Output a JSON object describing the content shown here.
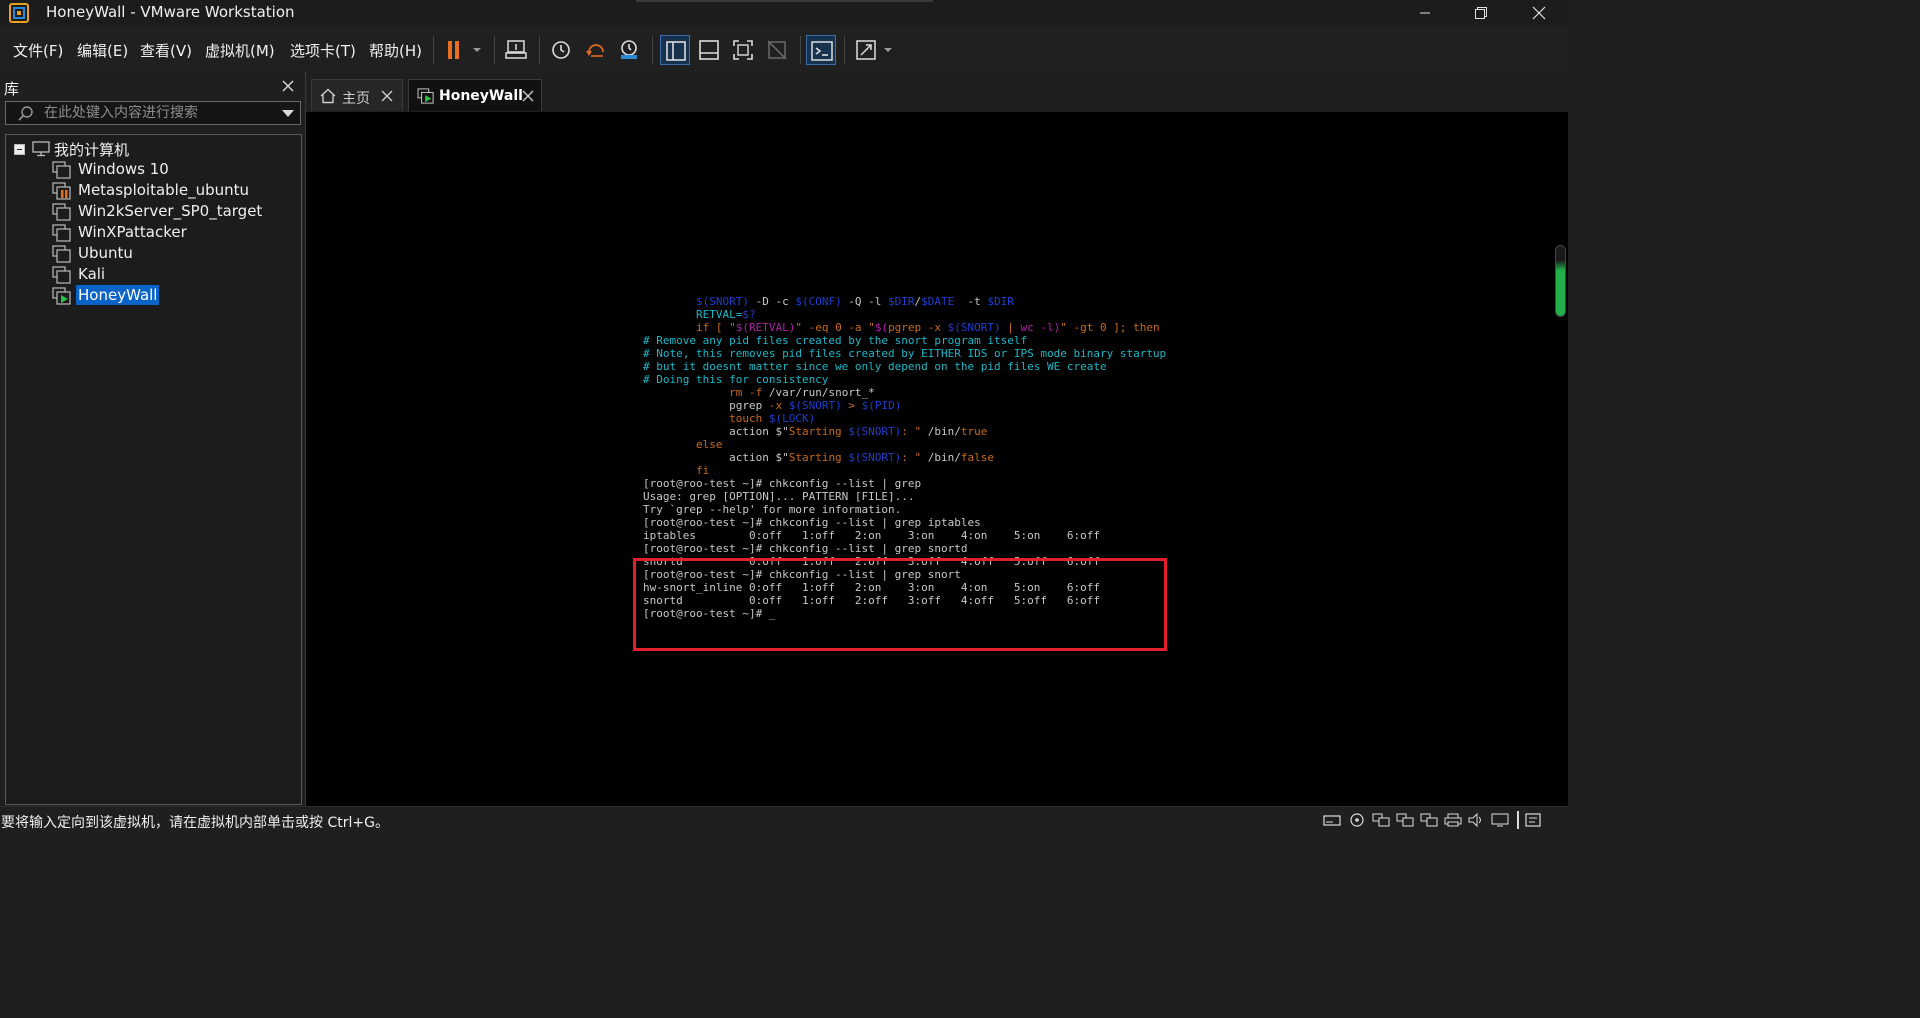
{
  "window": {
    "title": "HoneyWall - VMware Workstation"
  },
  "menu": {
    "items": [
      "文件(F)",
      "编辑(E)",
      "查看(V)",
      "虚拟机(M)",
      "选项卡(T)",
      "帮助(H)"
    ]
  },
  "toolbar": {
    "icons": [
      "pause-icon",
      "send-keys-icon",
      "snapshot-icon",
      "revert-snapshot-icon",
      "snapshot-manager-icon",
      "show-library-icon",
      "thumbnail-bar-icon",
      "full-screen-icon",
      "unity-icon",
      "console-view-icon",
      "stretch-icon"
    ]
  },
  "library": {
    "title": "库",
    "search_placeholder": "在此处键入内容进行搜索",
    "root_label": "我的计算机",
    "vms": [
      {
        "name": "Windows 10",
        "state": "off"
      },
      {
        "name": "Metasploitable_ubuntu",
        "state": "paused"
      },
      {
        "name": "Win2kServer_SP0_target",
        "state": "off"
      },
      {
        "name": "WinXPattacker",
        "state": "off"
      },
      {
        "name": "Ubuntu",
        "state": "off"
      },
      {
        "name": "Kali",
        "state": "off"
      },
      {
        "name": "HoneyWall",
        "state": "running",
        "selected": true
      }
    ]
  },
  "tabs": [
    {
      "label": "主页",
      "icon": "home-icon"
    },
    {
      "label": "HoneyWall",
      "icon": "vm-running-icon",
      "active": true
    }
  ],
  "console": {
    "lines": [
      [
        [
          "        ",
          "w"
        ],
        [
          "$(SNORT)",
          "b"
        ],
        [
          " -D -c ",
          "w"
        ],
        [
          "$(CONF)",
          "b"
        ],
        [
          " -Q -l ",
          "w"
        ],
        [
          "$DIR",
          "b"
        ],
        [
          "/",
          "w"
        ],
        [
          "$DATE",
          "b"
        ],
        [
          "  -t ",
          "w"
        ],
        [
          "$DIR",
          "b"
        ]
      ],
      [
        [
          "        RETVAL=",
          "c"
        ],
        [
          "$?",
          "b"
        ]
      ],
      [
        [
          "        if [ \"",
          "o"
        ],
        [
          "$(RETVAL)",
          "m"
        ],
        [
          "\" -eq 0 -a \"",
          "o"
        ],
        [
          "$(",
          "m"
        ],
        [
          "pgrep -x ",
          "o"
        ],
        [
          "$(SNORT)",
          "b"
        ],
        [
          " | ",
          "o"
        ],
        [
          "wc -l",
          "m"
        ],
        [
          ")",
          "m"
        ],
        [
          "\" -gt 0 ]; then",
          "o"
        ]
      ],
      [
        [
          "# Remove any pid files created by the snort program itself",
          "c"
        ]
      ],
      [
        [
          "# Note, this removes pid files created by EITHER IDS or IPS mode binary startup",
          "c"
        ]
      ],
      [
        [
          "# but it doesnt matter since we only depend on the pid files WE create",
          "c"
        ]
      ],
      [
        [
          "# Doing this for consistency",
          "c"
        ]
      ],
      [
        [
          "             rm -f ",
          "o"
        ],
        [
          "/var/run/snort_*",
          "w"
        ]
      ],
      [
        [
          "             pgrep ",
          "w"
        ],
        [
          "-x ",
          "o"
        ],
        [
          "$(SNORT)",
          "b"
        ],
        [
          " > ",
          "o"
        ],
        [
          "$(PID)",
          "b"
        ]
      ],
      [
        [
          "             touch ",
          "o"
        ],
        [
          "$(LOCK)",
          "b"
        ]
      ],
      [
        [
          "             action ",
          "w"
        ],
        [
          "$\"",
          "w"
        ],
        [
          "Starting ",
          "o"
        ],
        [
          "$(SNORT)",
          "b"
        ],
        [
          ": \"",
          "o"
        ],
        [
          " /bin/",
          "w"
        ],
        [
          "true",
          "o"
        ]
      ],
      [
        [
          "        else",
          "o"
        ]
      ],
      [
        [
          "             action ",
          "w"
        ],
        [
          "$\"",
          "w"
        ],
        [
          "Starting ",
          "o"
        ],
        [
          "$(SNORT)",
          "b"
        ],
        [
          ": \"",
          "o"
        ],
        [
          " /bin/",
          "w"
        ],
        [
          "false",
          "o"
        ]
      ],
      [
        [
          "        fi",
          "o"
        ]
      ],
      [
        [
          "[root@roo-test ~]# chkconfig --list | grep",
          "w"
        ]
      ],
      [
        [
          "Usage: grep [OPTION]... PATTERN [FILE]...",
          "w"
        ]
      ],
      [
        [
          "Try `grep --help' for more information.",
          "w"
        ]
      ],
      [
        [
          "[root@roo-test ~]# chkconfig --list | grep iptables",
          "w"
        ]
      ],
      [
        [
          "iptables        0:off   1:off   2:on    3:on    4:on    5:on    6:off",
          "w"
        ]
      ],
      [
        [
          "[root@roo-test ~]# chkconfig --list | grep snortd",
          "w"
        ]
      ],
      [
        [
          "snortd          0:off   1:off   2:off   3:off   4:off   5:off   6:off",
          "w"
        ]
      ],
      [
        [
          "[root@roo-test ~]# chkconfig --list | grep snort",
          "w"
        ]
      ],
      [
        [
          "hw-snort_inline 0:off   1:off   2:on    3:on    4:on    5:on    6:off",
          "w"
        ]
      ],
      [
        [
          "snortd          0:off   1:off   2:off   3:off   4:off   5:off   6:off",
          "w"
        ]
      ],
      [
        [
          "[root@roo-test ~]# _",
          "w"
        ]
      ]
    ]
  },
  "statusbar": {
    "message": "要将输入定向到该虚拟机，请在虚拟机内部单击或按 Ctrl+G。"
  }
}
